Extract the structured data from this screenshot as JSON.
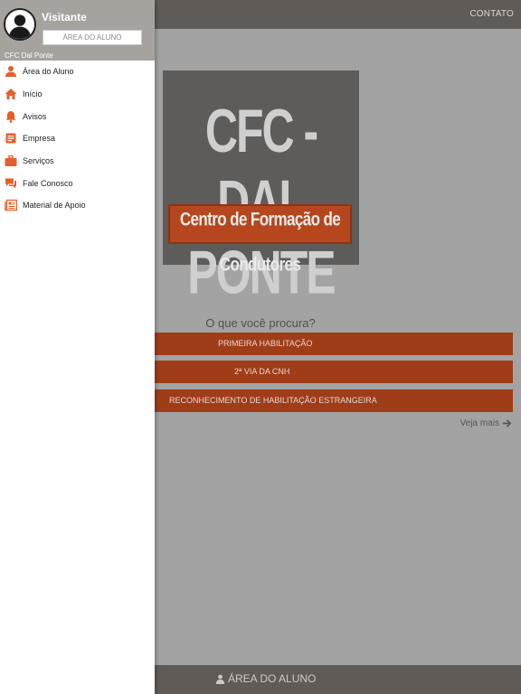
{
  "topbar": {
    "contact_label": "CONTATO"
  },
  "logo": {
    "title": "CFC - DAL PONTE",
    "subtitle": "Centro de Formação de Condutores"
  },
  "search": {
    "question": "O que você procura?",
    "options": [
      {
        "label": "PRIMEIRA HABILITAÇÃO"
      },
      {
        "label": "2ª VIA DA CNH"
      },
      {
        "label": "RECONHECIMENTO DE HABILITAÇÃO ESTRANGEIRA"
      }
    ],
    "see_more": "Veja mais"
  },
  "bottombar": {
    "label": "ÁREA DO ALUNO"
  },
  "drawer": {
    "user_name": "Visitante",
    "area_button": "ÁREA DO ALUNO",
    "caption": "CFC Dal Ponte",
    "items": [
      {
        "label": "Área do Aluno",
        "icon": "person-icon"
      },
      {
        "label": "Início",
        "icon": "home-icon"
      },
      {
        "label": "Avisos",
        "icon": "bell-icon"
      },
      {
        "label": "Empresa",
        "icon": "document-icon"
      },
      {
        "label": "Serviços",
        "icon": "briefcase-icon"
      },
      {
        "label": "Fale Conosco",
        "icon": "chat-icon"
      },
      {
        "label": "Material de Apoio",
        "icon": "newspaper-icon"
      }
    ]
  },
  "colors": {
    "accent": "#e4602a",
    "button": "#a03d19",
    "bar": "#605b57",
    "overlay_bg": "#a3a3a3"
  }
}
